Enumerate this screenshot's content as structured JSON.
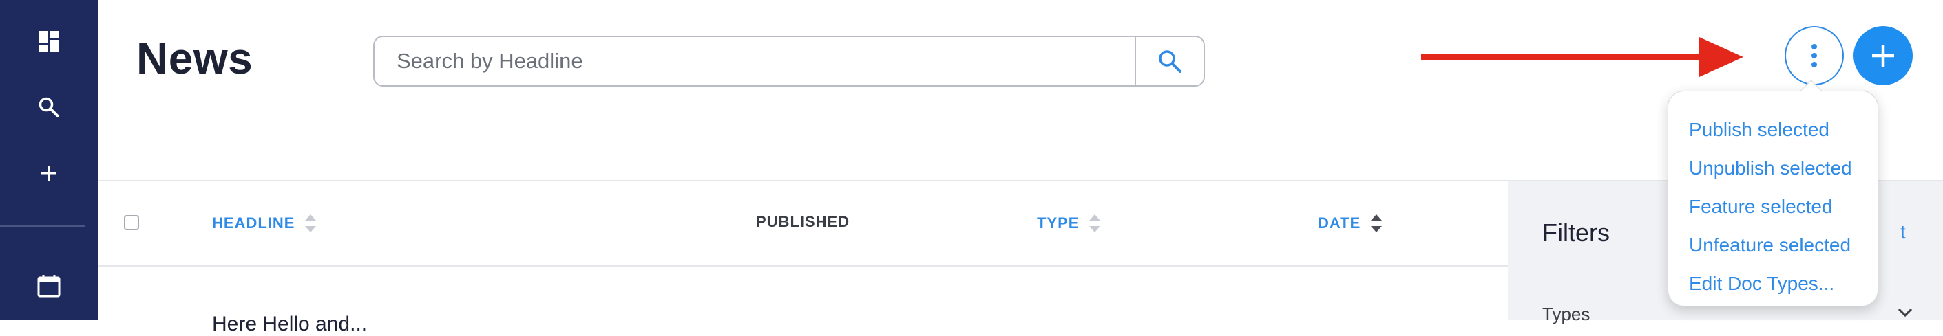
{
  "page": {
    "title": "News"
  },
  "search": {
    "placeholder": "Search by Headline"
  },
  "table": {
    "columns": [
      "HEADLINE",
      "PUBLISHED",
      "TYPE",
      "DATE"
    ],
    "rows": [
      {
        "headline": "Here Hello and..."
      }
    ]
  },
  "filters": {
    "title": "Filters",
    "action": "t",
    "types_label": "Types"
  },
  "actions_menu": {
    "items": [
      "Publish selected",
      "Unpublish selected",
      "Feature selected",
      "Unfeature selected",
      "Edit Doc Types..."
    ]
  },
  "icons": {
    "sidebar": [
      "dashboard-icon",
      "search-icon",
      "plus-icon",
      "calendar-icon"
    ],
    "more": "vertical-dots-icon",
    "add": "plus-icon"
  },
  "colors": {
    "sidebar": "#1e2a5e",
    "accent": "#2e8ae6",
    "primary_button": "#1f8ef1",
    "annotation_arrow": "#e3281b"
  }
}
